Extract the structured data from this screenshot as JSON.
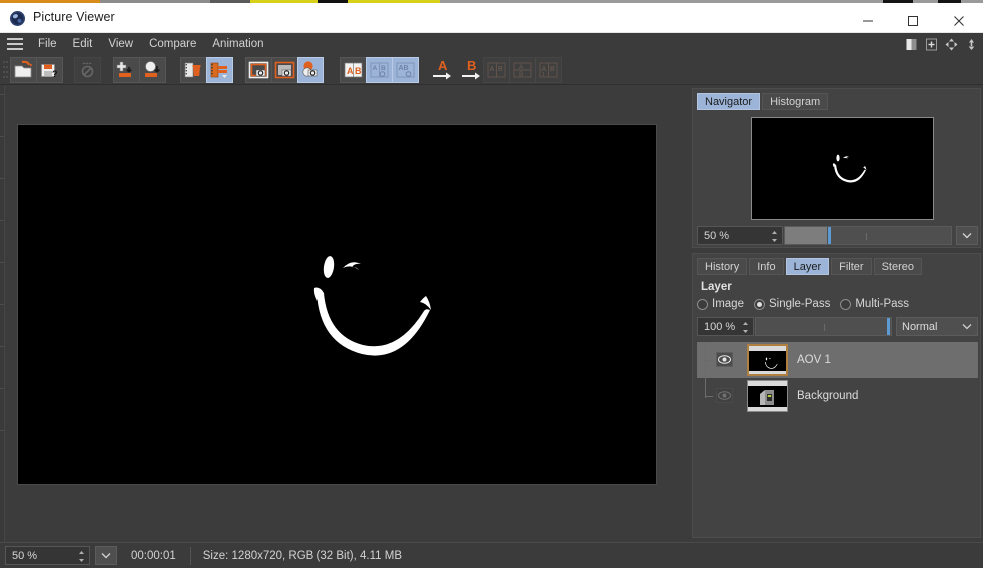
{
  "window": {
    "title": "Picture Viewer",
    "app_icon": "picture-viewer-icon",
    "minimize_label": "Minimize",
    "maximize_label": "Maximize",
    "close_label": "Close"
  },
  "menubar": {
    "hamburger_label": "Menu",
    "items": [
      {
        "label": "File"
      },
      {
        "label": "Edit"
      },
      {
        "label": "View"
      },
      {
        "label": "Compare"
      },
      {
        "label": "Animation"
      }
    ],
    "right_icons": [
      {
        "name": "contrast-icon",
        "label": "Contrast"
      },
      {
        "name": "add-panel-icon",
        "label": "Add Panel"
      },
      {
        "name": "move-icon",
        "label": "Move"
      },
      {
        "name": "dock-icon",
        "label": "Dock"
      }
    ]
  },
  "toolbar": {
    "groups": [
      {
        "buttons": [
          {
            "name": "open-image-button",
            "label": "Open Image",
            "state": "normal"
          },
          {
            "name": "save-image-button",
            "label": "Save Image As",
            "state": "normal"
          }
        ]
      },
      {
        "buttons": [
          {
            "name": "render-settings-button",
            "label": "Render Settings",
            "state": "disabled"
          }
        ]
      },
      {
        "buttons": [
          {
            "name": "render-region-button",
            "label": "Render Region",
            "state": "normal"
          },
          {
            "name": "render-view-button",
            "label": "Render View",
            "state": "normal"
          }
        ]
      },
      {
        "buttons": [
          {
            "name": "clear-frame-button",
            "label": "Clear Frame",
            "state": "normal"
          },
          {
            "name": "clear-all-frames-button",
            "label": "Clear All Frames",
            "state": "selected"
          }
        ]
      },
      {
        "buttons": [
          {
            "name": "view-image-a-button",
            "label": "View Image A",
            "state": "normal"
          },
          {
            "name": "view-image-b-button",
            "label": "View Image B",
            "state": "normal"
          },
          {
            "name": "compare-ab-button",
            "label": "Compare A and B",
            "state": "selected"
          }
        ]
      },
      {
        "buttons": [
          {
            "name": "set-ab-button",
            "label": "Set A/B",
            "state": "normal"
          },
          {
            "name": "ab-side-by-side-button",
            "label": "A/B Side by Side",
            "state": "selected"
          },
          {
            "name": "ab-overlay-button",
            "label": "A/B Overlay",
            "state": "selected"
          }
        ]
      },
      {
        "buttons": [
          {
            "name": "set-a-button",
            "label": "Set A",
            "state": "plain"
          },
          {
            "name": "set-b-button",
            "label": "Set B",
            "state": "plain"
          }
        ]
      },
      {
        "buttons": [
          {
            "name": "compare-mode-1-button",
            "label": "Compare Mode 1",
            "state": "disabled"
          },
          {
            "name": "compare-mode-2-button",
            "label": "Compare Mode 2",
            "state": "disabled"
          },
          {
            "name": "compare-mode-3-button",
            "label": "Compare Mode 3",
            "state": "disabled"
          }
        ]
      }
    ]
  },
  "viewer": {
    "image_alt": "Winking smiley face drawn in white brush strokes on black background"
  },
  "navigator_panel": {
    "tabs": [
      {
        "label": "Navigator",
        "active": true
      },
      {
        "label": "Histogram",
        "active": false
      }
    ],
    "zoom": {
      "value": "50 %",
      "fill_percent": 25,
      "knob_percent": 26
    },
    "dropdown_label": "Zoom Presets"
  },
  "layer_panel": {
    "tabs": [
      {
        "label": "History",
        "active": false
      },
      {
        "label": "Info",
        "active": false
      },
      {
        "label": "Layer",
        "active": true
      },
      {
        "label": "Filter",
        "active": false
      },
      {
        "label": "Stereo",
        "active": false
      }
    ],
    "heading": "Layer",
    "modes": [
      {
        "label": "Image",
        "selected": false
      },
      {
        "label": "Single-Pass",
        "selected": true
      },
      {
        "label": "Multi-Pass",
        "selected": false
      }
    ],
    "opacity": {
      "value": "100 %",
      "fill_percent": 99
    },
    "blend_mode": "Normal",
    "layers": [
      {
        "name": "AOV 1",
        "visible": true,
        "selected": true
      },
      {
        "name": "Background",
        "visible": false,
        "selected": false
      }
    ]
  },
  "statusbar": {
    "zoom_value": "50 %",
    "zoom_dropdown_label": "Zoom Presets",
    "time": "00:00:01",
    "info": "Size: 1280x720, RGB (32 Bit), 4.11 MB"
  },
  "colors": {
    "window_chrome": "#3b3b3b",
    "panel_bg": "#434343",
    "accent_selected": "#9cb4d8",
    "accent_orange": "#e0611f",
    "canvas_black": "#000000",
    "text": "#d2d2d2",
    "slider_knob": "#5d9ad2",
    "thumb_border_selected": "#b08040"
  }
}
